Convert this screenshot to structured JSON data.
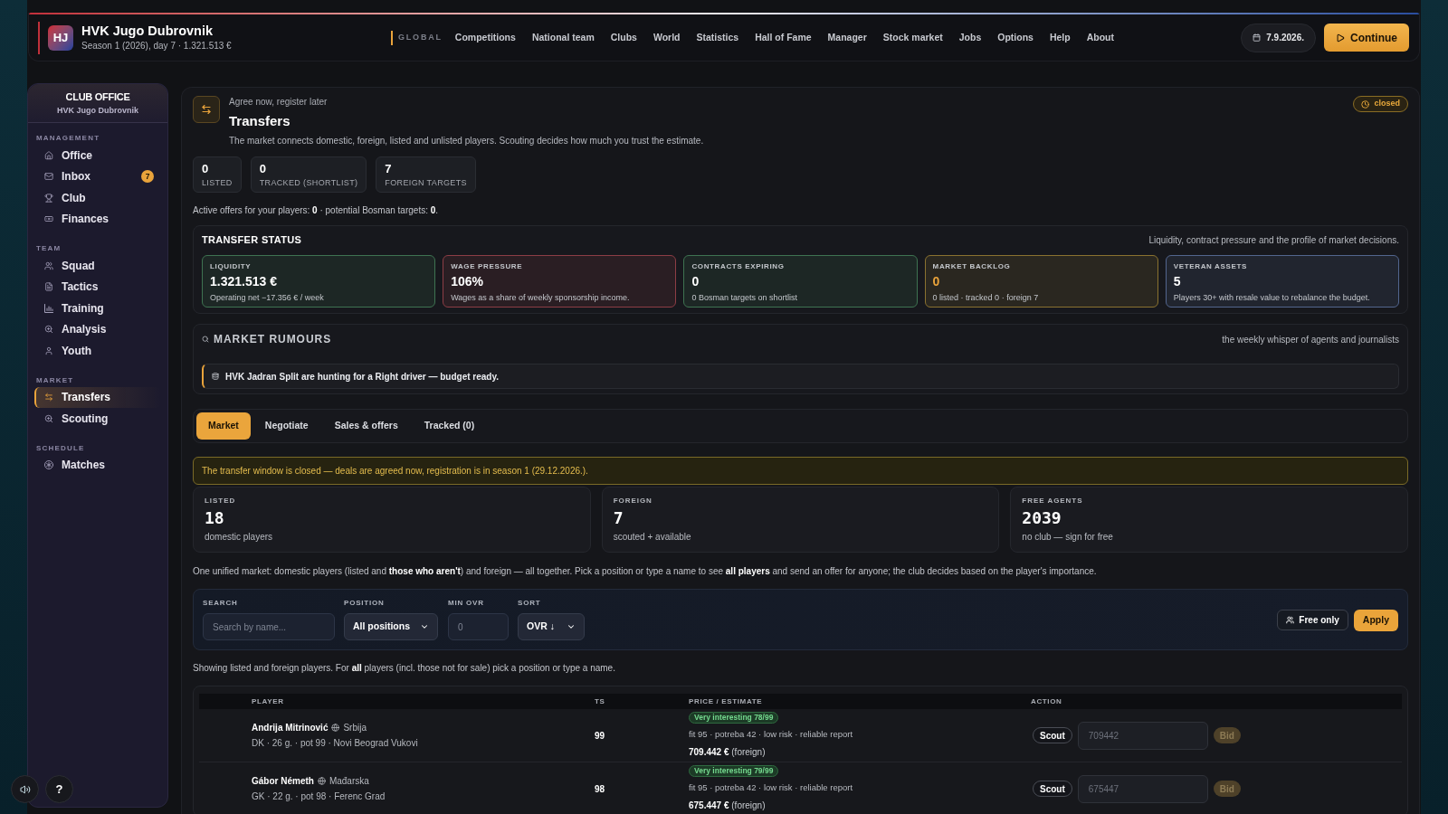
{
  "top_bar": {
    "club_logo": "HJ",
    "club_name": "HVK Jugo Dubrovnik",
    "subtitle": "Season 1 (2026), day 7 · 1.321.513 €",
    "nav_group_label": "GLOBAL",
    "nav_items": [
      "Competitions",
      "National team",
      "Clubs",
      "World",
      "Statistics",
      "Hall of Fame",
      "Manager",
      "Stock market",
      "Jobs",
      "Options",
      "Help",
      "About"
    ],
    "date": "7.9.2026.",
    "continue_button": "Continue"
  },
  "sidebar": {
    "title": "CLUB OFFICE",
    "subtitle": "HVK Jugo Dubrovnik",
    "sections": [
      {
        "label": "MANAGEMENT",
        "items": [
          {
            "label": "Office",
            "selected": false
          },
          {
            "label": "Inbox",
            "selected": false,
            "badge": "7"
          },
          {
            "label": "Club",
            "selected": false
          },
          {
            "label": "Finances",
            "selected": false
          }
        ]
      },
      {
        "label": "TEAM",
        "items": [
          {
            "label": "Squad",
            "selected": false
          },
          {
            "label": "Tactics",
            "selected": false
          },
          {
            "label": "Training",
            "selected": false
          },
          {
            "label": "Analysis",
            "selected": false
          },
          {
            "label": "Youth",
            "selected": false
          }
        ]
      },
      {
        "label": "MARKET",
        "items": [
          {
            "label": "Transfers",
            "selected": true
          },
          {
            "label": "Scouting",
            "selected": false
          }
        ]
      },
      {
        "label": "SCHEDULE",
        "items": [
          {
            "label": "Matches",
            "selected": false
          }
        ]
      }
    ]
  },
  "floating_buttons": {
    "help_button": "?"
  },
  "page_header": {
    "eyebrow": "Agree now, register later",
    "title": "Transfers",
    "description": "The market connects domestic, foreign, listed and unlisted players. Scouting decides how much you trust the estimate.",
    "status_badge": "closed"
  },
  "summary_chips": [
    {
      "value": "0",
      "label": "LISTED"
    },
    {
      "value": "0",
      "label": "TRACKED (SHORTLIST)"
    },
    {
      "value": "7",
      "label": "FOREIGN TARGETS"
    }
  ],
  "offers_note": "Active offers for your players: **0** · potential Bosman targets: **0**.",
  "transfer_status": {
    "title": "TRANSFER STATUS",
    "caption": "Liquidity, contract pressure and the profile of market decisions.",
    "cards": [
      {
        "label": "LIQUIDITY",
        "value": "1.321.513 €",
        "note": "Operating net −17.356 € / week",
        "color": "#3e7351",
        "value_highlighted": false
      },
      {
        "label": "WAGE PRESSURE",
        "value": "106%",
        "note": "Wages as a share of weekly sponsorship income.",
        "color": "#8c3d45",
        "value_highlighted": false
      },
      {
        "label": "CONTRACTS EXPIRING",
        "value": "0",
        "note": "0 Bosman targets on shortlist",
        "color": "#3e7351",
        "value_highlighted": false
      },
      {
        "label": "MARKET BACKLOG",
        "value": "0",
        "note": "0 listed · tracked 0 · foreign 7",
        "color": "#8a7230",
        "value_highlighted": true
      },
      {
        "label": "VETERAN ASSETS",
        "value": "5",
        "note": "Players 30+ with resale value to rebalance the budget.",
        "color": "#52658e",
        "value_highlighted": false
      }
    ]
  },
  "market_rumours": {
    "title": "MARKET RUMOURS",
    "caption": "the weekly whisper of agents and journalists",
    "items": [
      "HVK Jadran Split are hunting for a Right driver — budget ready."
    ]
  },
  "tabs": [
    {
      "label": "Market",
      "selected": true
    },
    {
      "label": "Negotiate",
      "selected": false
    },
    {
      "label": "Sales & offers",
      "selected": false
    },
    {
      "label": "Tracked (0)",
      "selected": false
    }
  ],
  "window_notice": "The transfer window is closed — deals are agreed now, registration is in season 1 (29.12.2026.).",
  "market_stats": [
    {
      "label": "LISTED",
      "value": "18",
      "note": "domestic players"
    },
    {
      "label": "FOREIGN",
      "value": "7",
      "note": "scouted + available"
    },
    {
      "label": "FREE AGENTS",
      "value": "2039",
      "note": "no club — sign for free"
    }
  ],
  "market_intro": "One unified market: domestic players (listed and **those who aren't**) and foreign — all together. Pick a position or type a name to see **all players** and send an offer for anyone; the club decides based on the player's importance.",
  "filters": {
    "search": {
      "label": "SEARCH",
      "placeholder": "Search by name..."
    },
    "position": {
      "label": "POSITION",
      "value": "All positions"
    },
    "min_ovr": {
      "label": "MIN OVR",
      "placeholder": "0"
    },
    "sort": {
      "label": "SORT",
      "value": "OVR ↓"
    },
    "free_only_button": "Free only",
    "apply_button": "Apply"
  },
  "list_note": "Showing listed and foreign players. For **all** players (incl. those not for sale) pick a position or type a name.",
  "table": {
    "columns": [
      "PLAYER",
      "TS",
      "PRICE / ESTIMATE",
      "ACTION"
    ],
    "rows": [
      {
        "name": "Andrija Mitrinović",
        "nationality": "Srbija",
        "details": "DK · 26 g. · pot 99 · Novi Beograd Vukovi",
        "ts": "99",
        "rating_badge": "Very interesting 78/99",
        "report": "fit 95 · potreba 42 · low risk · reliable report",
        "price": "**709.442 €** (foreign)",
        "scout_button": "Scout",
        "bid_placeholder": "709442",
        "bid_button": "Bid",
        "bid_disabled": true
      },
      {
        "name": "Gábor Németh",
        "nationality": "Mađarska",
        "details": "GK · 22 g. · pot 98 · Ferenc Grad",
        "ts": "98",
        "rating_badge": "Very interesting 79/99",
        "report": "fit 95 · potreba 42 · low risk · reliable report",
        "price": "**675.447 €** (foreign)",
        "scout_button": "Scout",
        "bid_placeholder": "675447",
        "bid_button": "Bid",
        "bid_disabled": true
      }
    ]
  }
}
